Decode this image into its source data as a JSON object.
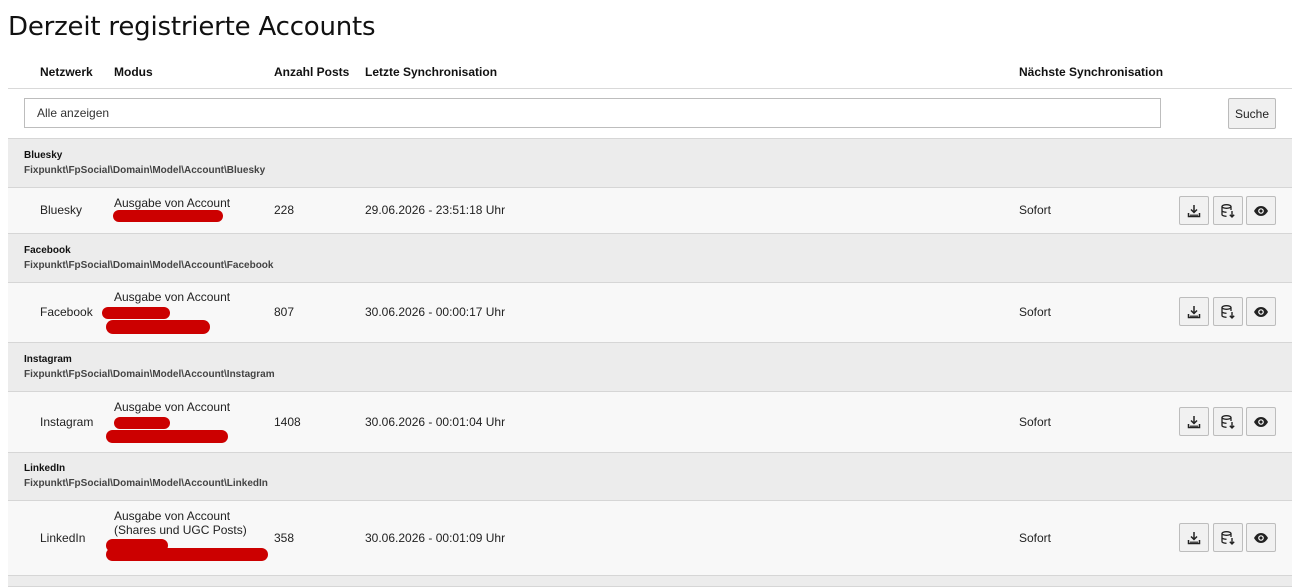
{
  "page": {
    "title": "Derzeit registrierte Accounts"
  },
  "table": {
    "headers": {
      "network": "Netzwerk",
      "mode": "Modus",
      "posts": "Anzahl Posts",
      "last_sync": "Letzte Synchronisation",
      "next_sync": "Nächste Synchronisation"
    }
  },
  "filter": {
    "value": "Alle anzeigen",
    "search_label": "Suche"
  },
  "groups": [
    {
      "name": "Bluesky",
      "class": "Fixpunkt\\FpSocial\\Domain\\Model\\Account\\Bluesky",
      "row": {
        "network": "Bluesky",
        "mode_line1": "Ausgabe von Account",
        "mode_line2": "",
        "posts": "228",
        "last_sync": "29.06.2026 - 23:51:18 Uhr",
        "next_sync": "Sofort"
      }
    },
    {
      "name": "Facebook",
      "class": "Fixpunkt\\FpSocial\\Domain\\Model\\Account\\Facebook",
      "row": {
        "network": "Facebook",
        "mode_line1": "Ausgabe von Account",
        "mode_line2": "",
        "posts": "807",
        "last_sync": "30.06.2026 - 00:00:17 Uhr",
        "next_sync": "Sofort"
      }
    },
    {
      "name": "Instagram",
      "class": "Fixpunkt\\FpSocial\\Domain\\Model\\Account\\Instagram",
      "row": {
        "network": "Instagram",
        "mode_line1": "Ausgabe von Account",
        "mode_line2": "",
        "posts": "1408",
        "last_sync": "30.06.2026 - 00:01:04 Uhr",
        "next_sync": "Sofort"
      }
    },
    {
      "name": "LinkedIn",
      "class": "Fixpunkt\\FpSocial\\Domain\\Model\\Account\\LinkedIn",
      "row": {
        "network": "LinkedIn",
        "mode_line1": "Ausgabe von Account",
        "mode_line2": "(Shares und UGC Posts)",
        "posts": "358",
        "last_sync": "30.06.2026 - 00:01:09 Uhr",
        "next_sync": "Sofort"
      }
    }
  ],
  "icons": {
    "import": "download-tray-icon",
    "import_db": "database-download-icon",
    "view": "eye-icon"
  }
}
